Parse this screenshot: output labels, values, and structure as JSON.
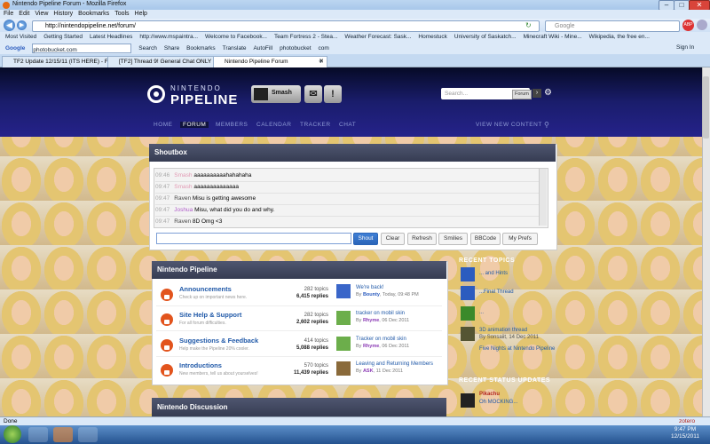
{
  "window": {
    "title": "Nintendo Pipeline Forum - Mozilla Firefox"
  },
  "menu": [
    "File",
    "Edit",
    "View",
    "History",
    "Bookmarks",
    "Tools",
    "Help"
  ],
  "address": {
    "url": "http://nintendopipeline.net/forum/"
  },
  "google_search": {
    "placeholder": "Google"
  },
  "bookmarks": [
    "Most Visited",
    "Getting Started",
    "Latest Headlines",
    "http://www.mspaintra...",
    "Welcome to Facebook...",
    "Team Fortress 2 - Stea...",
    "Weather Forecast: Sask...",
    "Homestuck",
    "University of Saskatch...",
    "Minecraft Wiki - Mine...",
    "Wikipedia, the free en..."
  ],
  "toolbar2": {
    "google_label": "Google",
    "google_value": "photobucket.com",
    "items": [
      "Search",
      "Share",
      "Bookmarks",
      "Translate",
      "AutoFill",
      "photobucket",
      "com"
    ],
    "signin": "Sign In"
  },
  "tabs": [
    {
      "label": "TF2 Update 12/15/11 (ITS HERE) - F..."
    },
    {
      "label": "[TF2] Thread 9! General Chat ONLY ..."
    },
    {
      "label": "Nintendo Pipeline Forum"
    }
  ],
  "site": {
    "logo_top": "NINTENDO",
    "logo_main": "PIPELINE",
    "username": "Smash",
    "search_placeholder": "Search...",
    "search_scope": "Forum",
    "nav": [
      "HOME",
      "FORUM",
      "MEMBERS",
      "CALENDAR",
      "TRACKER",
      "CHAT",
      "VIEW NEW CONTENT"
    ]
  },
  "shoutbox": {
    "title": "Shoutbox",
    "shouts": [
      {
        "time": "09:46",
        "user": "Smash",
        "text": "aaaaaaaaaahahahaha",
        "color": "#e29ab4"
      },
      {
        "time": "09:47",
        "user": "Smash",
        "text": "aaaaaaaaaaaaaa",
        "color": "#e29ab4"
      },
      {
        "time": "09:47",
        "user": "Raven",
        "text": "Misu is getting awesome",
        "color": "#444444"
      },
      {
        "time": "09:47",
        "user": "Joshua",
        "text": "Misu, what did you do and why.",
        "color": "#b05ec9"
      },
      {
        "time": "09:47",
        "user": "Raven",
        "text": "8D Omg <3",
        "color": "#444444"
      }
    ],
    "buttons": {
      "shout": "Shout",
      "clear": "Clear",
      "refresh": "Refresh",
      "smilies": "Smilies",
      "bbcode": "BBCode",
      "prefs": "My Prefs"
    }
  },
  "category1": {
    "title": "Nintendo Pipeline",
    "forums": [
      {
        "name": "Announcements",
        "desc": "Check up on important news here.",
        "topics": "282 topics",
        "replies": "6,415 replies",
        "last_title": "We're back!",
        "last_by": "By",
        "last_user": "Bounty",
        "last_date": ", Today, 09:48 PM"
      },
      {
        "name": "Site Help & Support",
        "desc": "For all forum difficulties.",
        "topics": "282 topics",
        "replies": "2,602 replies",
        "last_title": "tracker on mobil skin",
        "last_by": "By",
        "last_user": "Rhyme",
        "last_date": ", 06 Dec 2011"
      },
      {
        "name": "Suggestions & Feedback",
        "desc": "Help make the Pipeline 20% cooler.",
        "topics": "414 topics",
        "replies": "5,088 replies",
        "last_title": "Tracker on mobil skin",
        "last_by": "By",
        "last_user": "Rhyme",
        "last_date": ", 06 Dec 2011"
      },
      {
        "name": "Introductions",
        "desc": "New members, tell us about yourselves!",
        "topics": "570 topics",
        "replies": "11,439 replies",
        "last_title": "Leaving and Returning Members",
        "last_by": "By",
        "last_user": "ASK",
        "last_date": ", 11 Dec 2011"
      }
    ]
  },
  "category2": {
    "title": "Nintendo Discussion"
  },
  "sidebar": {
    "recent_topics": "RECENT TOPICS",
    "topics": [
      "... and Hints",
      "...Final Thread",
      "...",
      "3D animation thread",
      "Five Nights at Nintendo Pipeline"
    ],
    "topic_meta": [
      "By Sonsaiit, 14 Dec 2011"
    ],
    "recent_status": "RECENT STATUS UPDATES",
    "status_user": "Pikachu",
    "status_text": "Oh MOCKING..."
  },
  "statusbar": {
    "left": "Done",
    "right": "zotero"
  },
  "taskbar": {
    "time": "9:47 PM",
    "date": "12/15/2011"
  }
}
